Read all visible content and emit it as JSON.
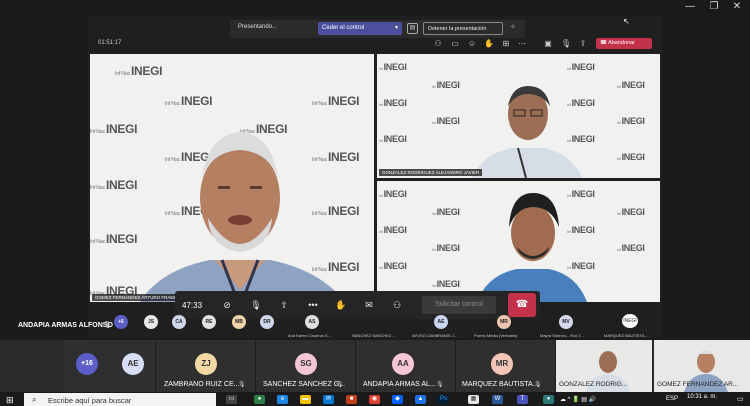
{
  "presenting_bar": {
    "presenting_label": "Presentando...",
    "give_control_label": "Ceder el control",
    "stop_presenting_label": "Detener la presentación"
  },
  "meeting": {
    "elapsed": "01:51:17",
    "leave_label": "Abandonar"
  },
  "tiles": {
    "main": {
      "name": "GOMEZ FERNANDEZ ARTURO FRANCISCO"
    },
    "top_right": {
      "name": "GONZALEZ RODRIGUEZ ALEJANDRO JAVIER"
    }
  },
  "watermark": {
    "brand": "INEGI",
    "small": "Inf Nac"
  },
  "controls": {
    "duration": "47:33",
    "request_control_label": "Solicitar control"
  },
  "strip": {
    "active_name": "ANDAPIA ARMAS ALFONSO",
    "overflow_count": "+6",
    "avatars": [
      {
        "initials": "JS",
        "color": "#e8e8e8"
      },
      {
        "initials": "CA",
        "color": "#cfd6ea"
      },
      {
        "initials": "RE",
        "color": "#e0e0e0"
      },
      {
        "initials": "MB",
        "color": "#f0d3a8"
      },
      {
        "initials": "DR",
        "color": "#cfd6ea"
      },
      {
        "initials": "AS",
        "color": "#dedede"
      }
    ],
    "labels": [
      "Ana Karen Cisneros S...",
      "SANCHEZ SANCHEZ ...",
      "AYUSO CAMBRANIS J...",
      "Puerto Medio (Verbatim)",
      "Mayra Sirenco... Rox T...",
      "MARQUEZ BAUTISTA ..."
    ],
    "extra_avatars": [
      {
        "initials": "AE",
        "color": "#c8d4f0"
      },
      {
        "initials": "MR",
        "color": "#efc7b0"
      },
      {
        "initials": "MV",
        "color": "#d6d8f0"
      }
    ]
  },
  "bottom": {
    "overflow": "+16",
    "participants": [
      {
        "initials": "AE",
        "name": "",
        "color": "#d9def7"
      },
      {
        "initials": "ZJ",
        "name": "ZAMBRANO RUIZ CE...",
        "color": "#f3d9a4"
      },
      {
        "initials": "SG",
        "name": "SANCHEZ SANCHEZ G...",
        "color": "#f6c6d6"
      },
      {
        "initials": "AA",
        "name": "ANDAPIA ARMAS AL...",
        "color": "#f6c6d6"
      },
      {
        "initials": "MR",
        "name": "MARQUEZ BAUTISTA...",
        "color": "#f4c6b7"
      }
    ],
    "video_names": [
      "GONZALEZ RODRIG...",
      "GOMEZ FERNANDEZ AR..."
    ]
  },
  "taskbar": {
    "search_placeholder": "Escribe aquí para buscar",
    "lang": "ESP",
    "time": "10:31 a. m."
  },
  "colors": {
    "brand_purple": "#4b4f9c",
    "leave_red": "#c4314b",
    "tile_bg": "#f1f1ef"
  }
}
